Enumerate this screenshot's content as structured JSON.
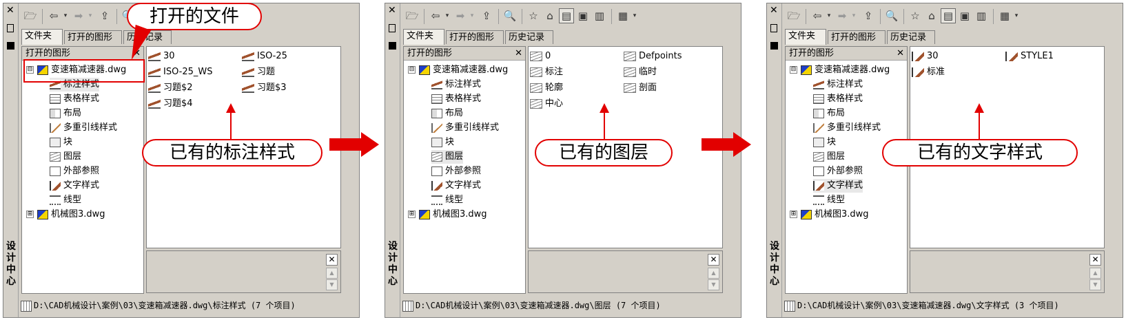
{
  "palette": {
    "accent_red": "#e20000",
    "panel_bg": "#d4d0c8"
  },
  "panels": [
    {
      "vertical_title": "设计中心",
      "tabs": [
        "文件夹",
        "打开的图形",
        "历史记录"
      ],
      "tree_header": "打开的图形",
      "tree": [
        {
          "label": "变速箱减速器.dwg",
          "icon": "dwg-icon",
          "expander": "⊟"
        },
        {
          "label": "标注样式",
          "icon": "dimstyle-icon"
        },
        {
          "label": "表格样式",
          "icon": "tablestyle-icon"
        },
        {
          "label": "布局",
          "icon": "layout-icon"
        },
        {
          "label": "多重引线样式",
          "icon": "mleaderstyle-icon"
        },
        {
          "label": "块",
          "icon": "block-icon"
        },
        {
          "label": "图层",
          "icon": "layer-icon"
        },
        {
          "label": "外部参照",
          "icon": "xref-icon"
        },
        {
          "label": "文字样式",
          "icon": "textstyle-icon"
        },
        {
          "label": "线型",
          "icon": "linetype-icon"
        },
        {
          "label": "机械图3.dwg",
          "icon": "dwg-icon",
          "expander": "⊞"
        }
      ],
      "selected_tree_index": 1,
      "content_items": [
        {
          "label": "30",
          "icon": "dimstyle-icon"
        },
        {
          "label": "ISO-25",
          "icon": "dimstyle-icon"
        },
        {
          "label": "ISO-25_WS",
          "icon": "dimstyle-icon"
        },
        {
          "label": "习题",
          "icon": "dimstyle-icon"
        },
        {
          "label": "习题$2",
          "icon": "dimstyle-icon"
        },
        {
          "label": "习题$3",
          "icon": "dimstyle-icon"
        },
        {
          "label": "习题$4",
          "icon": "dimstyle-icon"
        }
      ],
      "status": "D:\\CAD机械设计\\案例\\03\\变速箱减速器.dwg\\标注样式 (7 个项目)",
      "callout": "已有的标注样式"
    },
    {
      "vertical_title": "设计中心",
      "tabs": [
        "文件夹",
        "打开的图形",
        "历史记录"
      ],
      "tree_header": "打开的图形",
      "tree": [
        {
          "label": "变速箱减速器.dwg",
          "icon": "dwg-icon",
          "expander": "⊟"
        },
        {
          "label": "标注样式",
          "icon": "dimstyle-icon"
        },
        {
          "label": "表格样式",
          "icon": "tablestyle-icon"
        },
        {
          "label": "布局",
          "icon": "layout-icon"
        },
        {
          "label": "多重引线样式",
          "icon": "mleaderstyle-icon"
        },
        {
          "label": "块",
          "icon": "block-icon"
        },
        {
          "label": "图层",
          "icon": "layer-icon"
        },
        {
          "label": "外部参照",
          "icon": "xref-icon"
        },
        {
          "label": "文字样式",
          "icon": "textstyle-icon"
        },
        {
          "label": "线型",
          "icon": "linetype-icon"
        },
        {
          "label": "机械图3.dwg",
          "icon": "dwg-icon",
          "expander": "⊞"
        }
      ],
      "selected_tree_index": 6,
      "content_items": [
        {
          "label": "0",
          "icon": "layer-icon"
        },
        {
          "label": "Defpoints",
          "icon": "layer-icon"
        },
        {
          "label": "标注",
          "icon": "layer-icon"
        },
        {
          "label": "临时",
          "icon": "layer-icon"
        },
        {
          "label": "轮廓",
          "icon": "layer-icon"
        },
        {
          "label": "剖面",
          "icon": "layer-icon"
        },
        {
          "label": "中心",
          "icon": "layer-icon"
        }
      ],
      "status": "D:\\CAD机械设计\\案例\\03\\变速箱减速器.dwg\\图层 (7 个项目)",
      "callout": "已有的图层"
    },
    {
      "vertical_title": "设计中心",
      "tabs": [
        "文件夹",
        "打开的图形",
        "历史记录"
      ],
      "tree_header": "打开的图形",
      "tree": [
        {
          "label": "变速箱减速器.dwg",
          "icon": "dwg-icon",
          "expander": "⊟"
        },
        {
          "label": "标注样式",
          "icon": "dimstyle-icon"
        },
        {
          "label": "表格样式",
          "icon": "tablestyle-icon"
        },
        {
          "label": "布局",
          "icon": "layout-icon"
        },
        {
          "label": "多重引线样式",
          "icon": "mleaderstyle-icon"
        },
        {
          "label": "块",
          "icon": "block-icon"
        },
        {
          "label": "图层",
          "icon": "layer-icon"
        },
        {
          "label": "外部参照",
          "icon": "xref-icon"
        },
        {
          "label": "文字样式",
          "icon": "textstyle-icon"
        },
        {
          "label": "线型",
          "icon": "linetype-icon"
        },
        {
          "label": "机械图3.dwg",
          "icon": "dwg-icon",
          "expander": "⊞"
        }
      ],
      "selected_tree_index": 8,
      "content_items": [
        {
          "label": "30",
          "icon": "textstyle-icon"
        },
        {
          "label": "STYLE1",
          "icon": "textstyle-icon"
        },
        {
          "label": "标准",
          "icon": "textstyle-icon"
        }
      ],
      "status": "D:\\CAD机械设计\\案例\\03\\变速箱减速器.dwg\\文字样式 (3 个项目)",
      "callout": "已有的文字样式"
    }
  ],
  "top_callout": "打开的文件"
}
